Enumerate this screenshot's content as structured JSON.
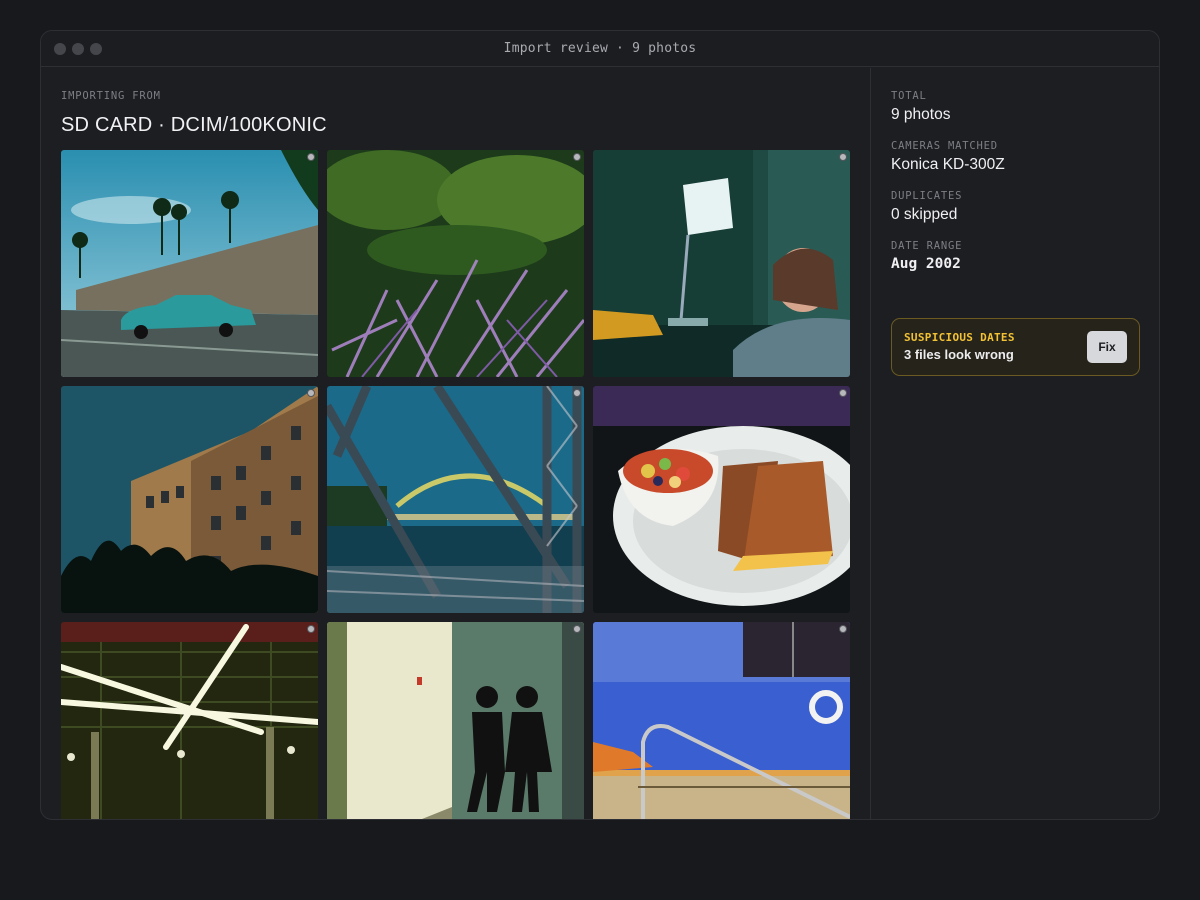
{
  "window": {
    "title": "Import review · 9 photos"
  },
  "source": {
    "label": "IMPORTING FROM",
    "title": "SD CARD · DCIM/100KONIC"
  },
  "photos": [
    {
      "subject": "classic car on highway with palm trees",
      "selected": true
    },
    {
      "subject": "purple fountain grass",
      "selected": true
    },
    {
      "subject": "desk lamp and child at table",
      "selected": true
    },
    {
      "subject": "apartment building against blue sky",
      "selected": true
    },
    {
      "subject": "steel truss bridge over river",
      "selected": true
    },
    {
      "subject": "fruit cup and grilled cheese sandwich",
      "selected": true
    },
    {
      "subject": "ceiling with light beams",
      "selected": true
    },
    {
      "subject": "restroom sign hallway",
      "selected": true
    },
    {
      "subject": "indoor pool with handrail and life ring",
      "selected": true
    }
  ],
  "stats": {
    "total_label": "TOTAL",
    "total_value": "9 photos",
    "cameras_label": "CAMERAS MATCHED",
    "cameras_value": "Konica KD-300Z",
    "duplicates_label": "DUPLICATES",
    "duplicates_value": "0 skipped",
    "date_label": "DATE RANGE",
    "date_value": "Aug 2002"
  },
  "alert": {
    "title": "SUSPICIOUS DATES",
    "message": "3 files look wrong",
    "action": "Fix"
  },
  "colors": {
    "accent_warning": "#f2c234",
    "background": "#18191d",
    "panel": "#1d1e22"
  }
}
